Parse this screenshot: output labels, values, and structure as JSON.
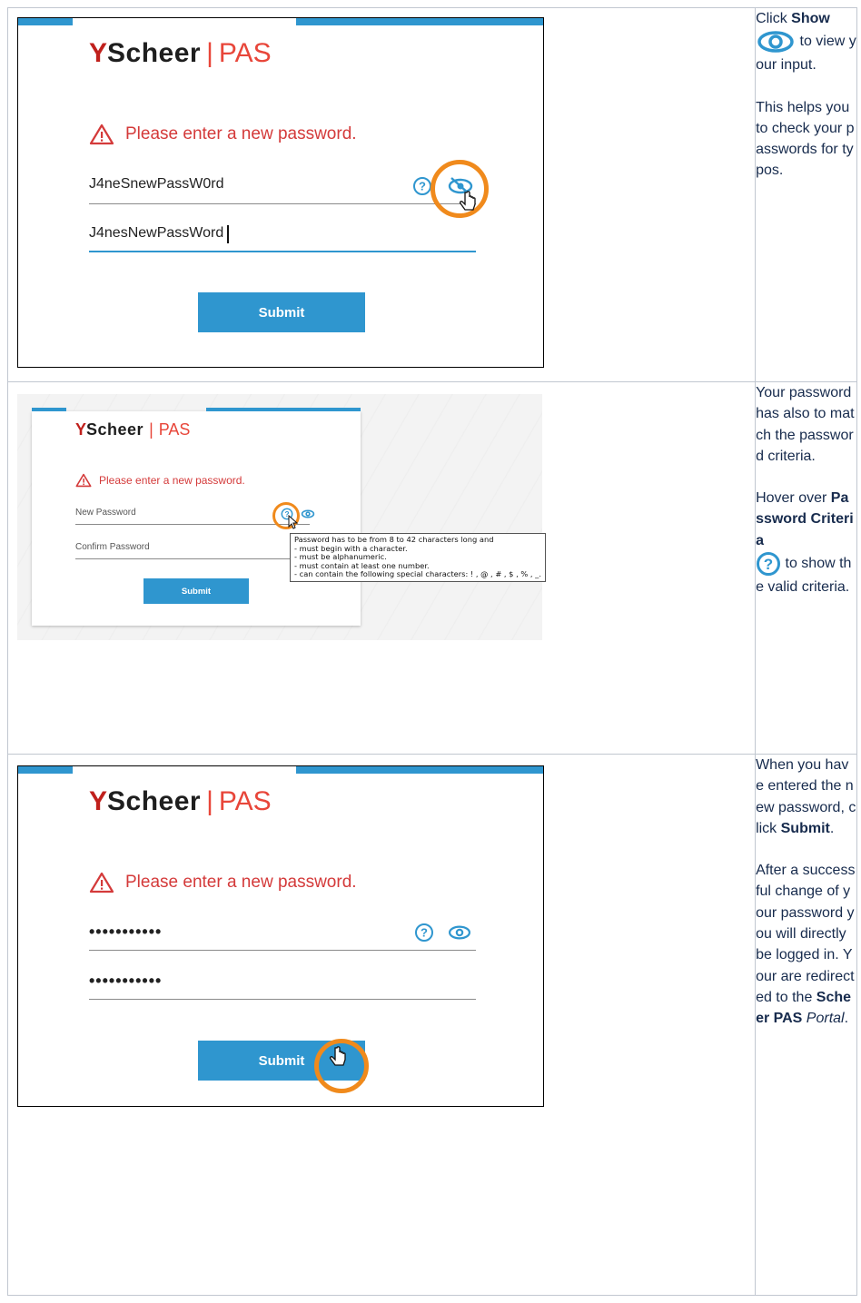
{
  "logo": {
    "mark": "Y",
    "brand": "Scheer",
    "separator": "|",
    "product": "PAS"
  },
  "step1": {
    "warning": "Please enter a new password.",
    "password_value": "J4neSnewPassW0rd",
    "confirm_value": "J4nesNewPassWord",
    "submit_label": "Submit",
    "text": {
      "p1a": "Click ",
      "p1b": "Show",
      "p1c": " to view your input.",
      "p2": "This helps you to check your passwords for typos."
    }
  },
  "step2": {
    "warning": "Please enter a new password.",
    "password_placeholder": "New Password",
    "confirm_placeholder": "Confirm Password",
    "submit_label": "Submit",
    "tooltip": [
      "Password has to be from 8 to 42 characters long and",
      "- must begin with a character.",
      "- must be alphanumeric.",
      "- must contain at least one number.",
      "- can contain the following special characters: ! , @ , # , $ , % , _."
    ],
    "text": {
      "p1": "Your password has also to match the password criteria.",
      "p2a": "Hover over ",
      "p2b": "Password Criteria",
      "p2c": " to show the valid criteria."
    }
  },
  "step3": {
    "warning": "Please enter a new password.",
    "password_value": "•••••••••••",
    "confirm_value": "•••••••••••",
    "submit_label": "Submit",
    "text": {
      "p1a": "When you have entered the new password, click ",
      "p1b": "Submit",
      "p1c": ".",
      "p2a": "After a successful change of your password you will directly be logged in. Your are redirected to the ",
      "p2b": "Scheer PAS",
      "p2c": " ",
      "p2d": "Portal",
      "p2e": "."
    }
  },
  "colors": {
    "accent": "#2f96cf",
    "error": "#d43a3a",
    "highlight": "#f08a1c"
  }
}
